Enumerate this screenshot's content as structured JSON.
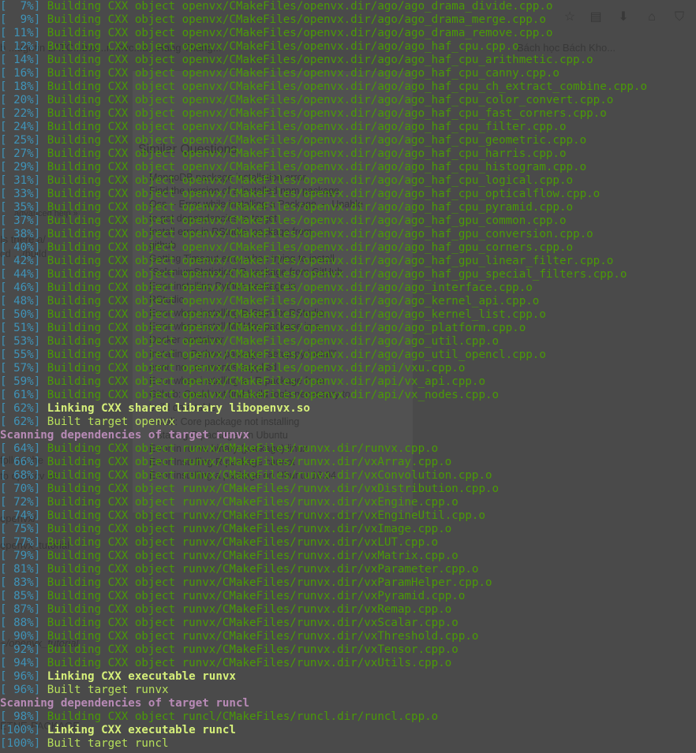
{
  "background_window": {
    "tab_title": "b ...ughtin LATC...bvx...r...hvc...a...Hang Tháng...",
    "tab_title_right": "Bách học Bách Kho...",
    "toolbar_icons": [
      "star-icon",
      "reader-icon",
      "download-icon",
      "home-icon",
      "pocket-icon"
    ],
    "side_fragments": [
      "advanced help »",
      "Is there a/",
      "cd .../build",
      "follow the",
      "to opencv as",
      "openvx_tutorial",
      "openvx/",
      "~/openvx_tutorial",
      "ETNE-PACKAGE"
    ],
    "similar_questions_title": "Similar Questions",
    "similar_questions": [
      "MongoDB package installation error",
      "Find the version of a installed npm package",
      "Oss -- Error while installing a Package — Unable",
      "to get dependencies to target",
      "Install error in RStudio: package from",
      "github",
      "Getting Timeout error when trying to install",
      "\"SeleniumStatistics\" R package from GitHub",
      "Error installing Python package in",
      "RStudio",
      "Error when installing R-Stan for RStudio",
      "Error when install MPI4py package in a",
      "Docker container",
      "Installing Python package \"setup.py install\"",
      "error: no commands supplied",
      "Error when installing an R package from",
      "Github: Could not find build tools necessary to",
      "build data table",
      "Install: Core package not installing",
      "Installing R packages in Ubuntu",
      "Error in runvx binary (package) linux",
      "Error Installing R package cannot",
      "Error installing a package on Ubuntu 16.04"
    ]
  },
  "terminal": {
    "lines": [
      {
        "kind": "building",
        "pct": "[  7%]",
        "msg": "Building CXX object openvx/CMakeFiles/openvx.dir/ago/ago_drama_divide.cpp.o"
      },
      {
        "kind": "building",
        "pct": "[  9%]",
        "msg": "Building CXX object openvx/CMakeFiles/openvx.dir/ago/ago_drama_merge.cpp.o"
      },
      {
        "kind": "building",
        "pct": "[ 11%]",
        "msg": "Building CXX object openvx/CMakeFiles/openvx.dir/ago/ago_drama_remove.cpp.o"
      },
      {
        "kind": "building",
        "pct": "[ 12%]",
        "msg": "Building CXX object openvx/CMakeFiles/openvx.dir/ago/ago_haf_cpu.cpp.o"
      },
      {
        "kind": "building",
        "pct": "[ 14%]",
        "msg": "Building CXX object openvx/CMakeFiles/openvx.dir/ago/ago_haf_cpu_arithmetic.cpp.o"
      },
      {
        "kind": "building",
        "pct": "[ 16%]",
        "msg": "Building CXX object openvx/CMakeFiles/openvx.dir/ago/ago_haf_cpu_canny.cpp.o"
      },
      {
        "kind": "building",
        "pct": "[ 18%]",
        "msg": "Building CXX object openvx/CMakeFiles/openvx.dir/ago/ago_haf_cpu_ch_extract_combine.cpp.o"
      },
      {
        "kind": "building",
        "pct": "[ 20%]",
        "msg": "Building CXX object openvx/CMakeFiles/openvx.dir/ago/ago_haf_cpu_color_convert.cpp.o"
      },
      {
        "kind": "building",
        "pct": "[ 22%]",
        "msg": "Building CXX object openvx/CMakeFiles/openvx.dir/ago/ago_haf_cpu_fast_corners.cpp.o"
      },
      {
        "kind": "building",
        "pct": "[ 24%]",
        "msg": "Building CXX object openvx/CMakeFiles/openvx.dir/ago/ago_haf_cpu_filter.cpp.o"
      },
      {
        "kind": "building",
        "pct": "[ 25%]",
        "msg": "Building CXX object openvx/CMakeFiles/openvx.dir/ago/ago_haf_cpu_geometric.cpp.o"
      },
      {
        "kind": "building",
        "pct": "[ 27%]",
        "msg": "Building CXX object openvx/CMakeFiles/openvx.dir/ago/ago_haf_cpu_harris.cpp.o"
      },
      {
        "kind": "building",
        "pct": "[ 29%]",
        "msg": "Building CXX object openvx/CMakeFiles/openvx.dir/ago/ago_haf_cpu_histogram.cpp.o"
      },
      {
        "kind": "building",
        "pct": "[ 31%]",
        "msg": "Building CXX object openvx/CMakeFiles/openvx.dir/ago/ago_haf_cpu_logical.cpp.o"
      },
      {
        "kind": "building",
        "pct": "[ 33%]",
        "msg": "Building CXX object openvx/CMakeFiles/openvx.dir/ago/ago_haf_cpu_opticalflow.cpp.o"
      },
      {
        "kind": "building",
        "pct": "[ 35%]",
        "msg": "Building CXX object openvx/CMakeFiles/openvx.dir/ago/ago_haf_cpu_pyramid.cpp.o"
      },
      {
        "kind": "building",
        "pct": "[ 37%]",
        "msg": "Building CXX object openvx/CMakeFiles/openvx.dir/ago/ago_haf_gpu_common.cpp.o"
      },
      {
        "kind": "building",
        "pct": "[ 38%]",
        "msg": "Building CXX object openvx/CMakeFiles/openvx.dir/ago/ago_haf_gpu_conversion.cpp.o"
      },
      {
        "kind": "building",
        "pct": "[ 40%]",
        "msg": "Building CXX object openvx/CMakeFiles/openvx.dir/ago/ago_haf_gpu_corners.cpp.o"
      },
      {
        "kind": "building",
        "pct": "[ 42%]",
        "msg": "Building CXX object openvx/CMakeFiles/openvx.dir/ago/ago_haf_gpu_linear_filter.cpp.o"
      },
      {
        "kind": "building",
        "pct": "[ 44%]",
        "msg": "Building CXX object openvx/CMakeFiles/openvx.dir/ago/ago_haf_gpu_special_filters.cpp.o"
      },
      {
        "kind": "building",
        "pct": "[ 46%]",
        "msg": "Building CXX object openvx/CMakeFiles/openvx.dir/ago/ago_interface.cpp.o"
      },
      {
        "kind": "building",
        "pct": "[ 48%]",
        "msg": "Building CXX object openvx/CMakeFiles/openvx.dir/ago/ago_kernel_api.cpp.o"
      },
      {
        "kind": "building",
        "pct": "[ 50%]",
        "msg": "Building CXX object openvx/CMakeFiles/openvx.dir/ago/ago_kernel_list.cpp.o"
      },
      {
        "kind": "building",
        "pct": "[ 51%]",
        "msg": "Building CXX object openvx/CMakeFiles/openvx.dir/ago/ago_platform.cpp.o"
      },
      {
        "kind": "building",
        "pct": "[ 53%]",
        "msg": "Building CXX object openvx/CMakeFiles/openvx.dir/ago/ago_util.cpp.o"
      },
      {
        "kind": "building",
        "pct": "[ 55%]",
        "msg": "Building CXX object openvx/CMakeFiles/openvx.dir/ago/ago_util_opencl.cpp.o"
      },
      {
        "kind": "building",
        "pct": "[ 57%]",
        "msg": "Building CXX object openvx/CMakeFiles/openvx.dir/api/vxu.cpp.o"
      },
      {
        "kind": "building",
        "pct": "[ 59%]",
        "msg": "Building CXX object openvx/CMakeFiles/openvx.dir/api/vx_api.cpp.o"
      },
      {
        "kind": "building",
        "pct": "[ 61%]",
        "msg": "Building CXX object openvx/CMakeFiles/openvx.dir/api/vx_nodes.cpp.o"
      },
      {
        "kind": "linking",
        "pct": "[ 62%]",
        "msg": "Linking CXX shared library libopenvx.so"
      },
      {
        "kind": "built",
        "pct": "[ 62%]",
        "msg": "Built target openvx"
      },
      {
        "kind": "scanning",
        "pct": "",
        "msg": "Scanning dependencies of target runvx"
      },
      {
        "kind": "building",
        "pct": "[ 64%]",
        "msg": "Building CXX object runvx/CMakeFiles/runvx.dir/runvx.cpp.o"
      },
      {
        "kind": "building",
        "pct": "[ 66%]",
        "msg": "Building CXX object runvx/CMakeFiles/runvx.dir/vxArray.cpp.o"
      },
      {
        "kind": "building",
        "pct": "[ 68%]",
        "msg": "Building CXX object runvx/CMakeFiles/runvx.dir/vxConvolution.cpp.o"
      },
      {
        "kind": "building",
        "pct": "[ 70%]",
        "msg": "Building CXX object runvx/CMakeFiles/runvx.dir/vxDistribution.cpp.o"
      },
      {
        "kind": "building",
        "pct": "[ 72%]",
        "msg": "Building CXX object runvx/CMakeFiles/runvx.dir/vxEngine.cpp.o"
      },
      {
        "kind": "building",
        "pct": "[ 74%]",
        "msg": "Building CXX object runvx/CMakeFiles/runvx.dir/vxEngineUtil.cpp.o"
      },
      {
        "kind": "building",
        "pct": "[ 75%]",
        "msg": "Building CXX object runvx/CMakeFiles/runvx.dir/vxImage.cpp.o"
      },
      {
        "kind": "building",
        "pct": "[ 77%]",
        "msg": "Building CXX object runvx/CMakeFiles/runvx.dir/vxLUT.cpp.o"
      },
      {
        "kind": "building",
        "pct": "[ 79%]",
        "msg": "Building CXX object runvx/CMakeFiles/runvx.dir/vxMatrix.cpp.o"
      },
      {
        "kind": "building",
        "pct": "[ 81%]",
        "msg": "Building CXX object runvx/CMakeFiles/runvx.dir/vxParameter.cpp.o"
      },
      {
        "kind": "building",
        "pct": "[ 83%]",
        "msg": "Building CXX object runvx/CMakeFiles/runvx.dir/vxParamHelper.cpp.o"
      },
      {
        "kind": "building",
        "pct": "[ 85%]",
        "msg": "Building CXX object runvx/CMakeFiles/runvx.dir/vxPyramid.cpp.o"
      },
      {
        "kind": "building",
        "pct": "[ 87%]",
        "msg": "Building CXX object runvx/CMakeFiles/runvx.dir/vxRemap.cpp.o"
      },
      {
        "kind": "building",
        "pct": "[ 88%]",
        "msg": "Building CXX object runvx/CMakeFiles/runvx.dir/vxScalar.cpp.o"
      },
      {
        "kind": "building",
        "pct": "[ 90%]",
        "msg": "Building CXX object runvx/CMakeFiles/runvx.dir/vxThreshold.cpp.o"
      },
      {
        "kind": "building",
        "pct": "[ 92%]",
        "msg": "Building CXX object runvx/CMakeFiles/runvx.dir/vxTensor.cpp.o"
      },
      {
        "kind": "building",
        "pct": "[ 94%]",
        "msg": "Building CXX object runvx/CMakeFiles/runvx.dir/vxUtils.cpp.o"
      },
      {
        "kind": "linking",
        "pct": "[ 96%]",
        "msg": "Linking CXX executable runvx"
      },
      {
        "kind": "built",
        "pct": "[ 96%]",
        "msg": "Built target runvx"
      },
      {
        "kind": "scanning",
        "pct": "",
        "msg": "Scanning dependencies of target runcl"
      },
      {
        "kind": "building",
        "pct": "[ 98%]",
        "msg": "Building CXX object runcl/CMakeFiles/runcl.dir/runcl.cpp.o"
      },
      {
        "kind": "linking",
        "pct": "[100%]",
        "msg": "Linking CXX executable runcl"
      },
      {
        "kind": "built",
        "pct": "[100%]",
        "msg": "Built target runcl"
      }
    ]
  }
}
